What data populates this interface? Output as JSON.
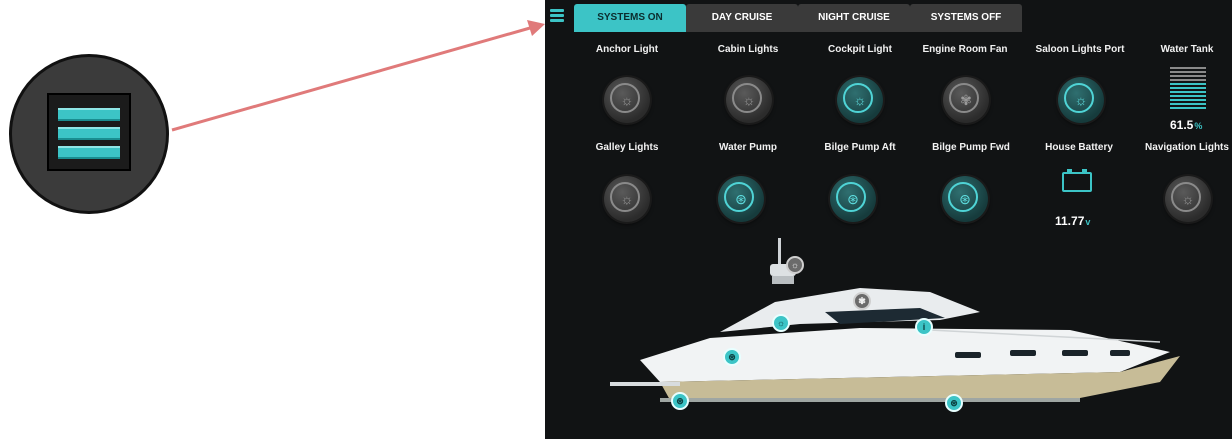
{
  "tabs": [
    {
      "label": "SYSTEMS ON",
      "active": true
    },
    {
      "label": "DAY CRUISE",
      "active": false
    },
    {
      "label": "NIGHT CRUISE",
      "active": false
    },
    {
      "label": "SYSTEMS OFF",
      "active": false
    }
  ],
  "controls_row1": [
    {
      "label": "Anchor Light",
      "icon": "light-bulb-icon",
      "state": "off"
    },
    {
      "label": "Cabin Lights",
      "icon": "light-bulb-icon",
      "state": "off"
    },
    {
      "label": "Cockpit Light",
      "icon": "light-bulb-icon",
      "state": "on"
    },
    {
      "label": "Engine Room Fan",
      "icon": "fan-icon",
      "state": "off"
    },
    {
      "label": "Saloon Lights Port",
      "icon": "light-bulb-icon",
      "state": "on"
    }
  ],
  "water_tank": {
    "label": "Water Tank",
    "value": "61.5",
    "unit": "%",
    "level": 0.615
  },
  "controls_row2": [
    {
      "label": "Galley Lights",
      "icon": "light-bulb-icon",
      "state": "off"
    },
    {
      "label": "Water Pump",
      "icon": "pump-icon",
      "state": "on"
    },
    {
      "label": "Bilge Pump Aft",
      "icon": "pump-icon",
      "state": "on"
    },
    {
      "label": "Bilge Pump Fwd",
      "icon": "pump-icon",
      "state": "on"
    }
  ],
  "house_battery": {
    "label": "House Battery",
    "value": "11.77",
    "unit": "v"
  },
  "navigation_lights": {
    "label": "Navigation Lights",
    "icon": "light-bulb-icon",
    "state": "off"
  },
  "page_indicator": {
    "count": 4,
    "current": 1
  },
  "colors": {
    "accent": "#3cc4c6",
    "panel_bg": "#111314",
    "tab_bg": "#3a3a3a",
    "arrow": "#e07a7a"
  }
}
